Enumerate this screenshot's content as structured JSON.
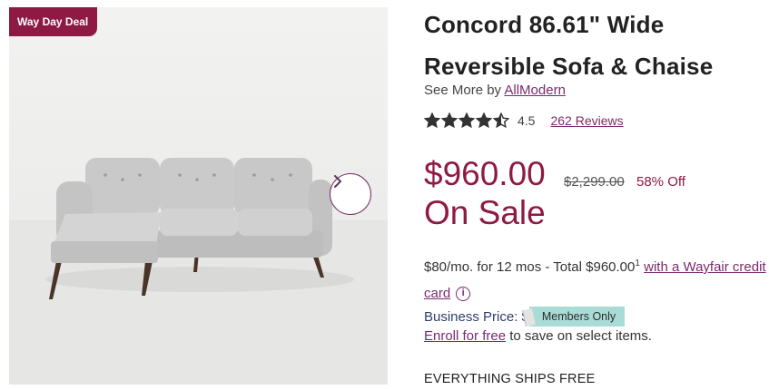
{
  "badge": "Way Day Deal",
  "product": {
    "title_line1": "Concord 86.61\" Wide",
    "title_line2": "Reversible Sofa & Chaise"
  },
  "brand": {
    "prefix": "See More by",
    "name": "AllModern"
  },
  "rating": {
    "value": "4.5",
    "reviews": "262 Reviews",
    "stars": 4.5
  },
  "price": {
    "current": "$960.00",
    "original": "$2,299.00",
    "discount": "58% Off",
    "sale_label": "On Sale"
  },
  "financing": {
    "text": "$80/mo. for 12 mos - Total $960.00",
    "footnote": "1",
    "link": "with a Wayfair credit card"
  },
  "business": {
    "label": "Business Price: $",
    "members_badge": "Members Only"
  },
  "enroll": {
    "link": "Enroll for free",
    "text": " to save on select items."
  },
  "shipping": "EVERYTHING SHIPS FREE",
  "colors": {
    "accent": "#8e1a43",
    "link": "#7b2a6e",
    "members_bg": "#a9dcd7"
  },
  "icons": {
    "next": "chevron-right-icon",
    "info": "info-icon",
    "star": "star-icon"
  }
}
